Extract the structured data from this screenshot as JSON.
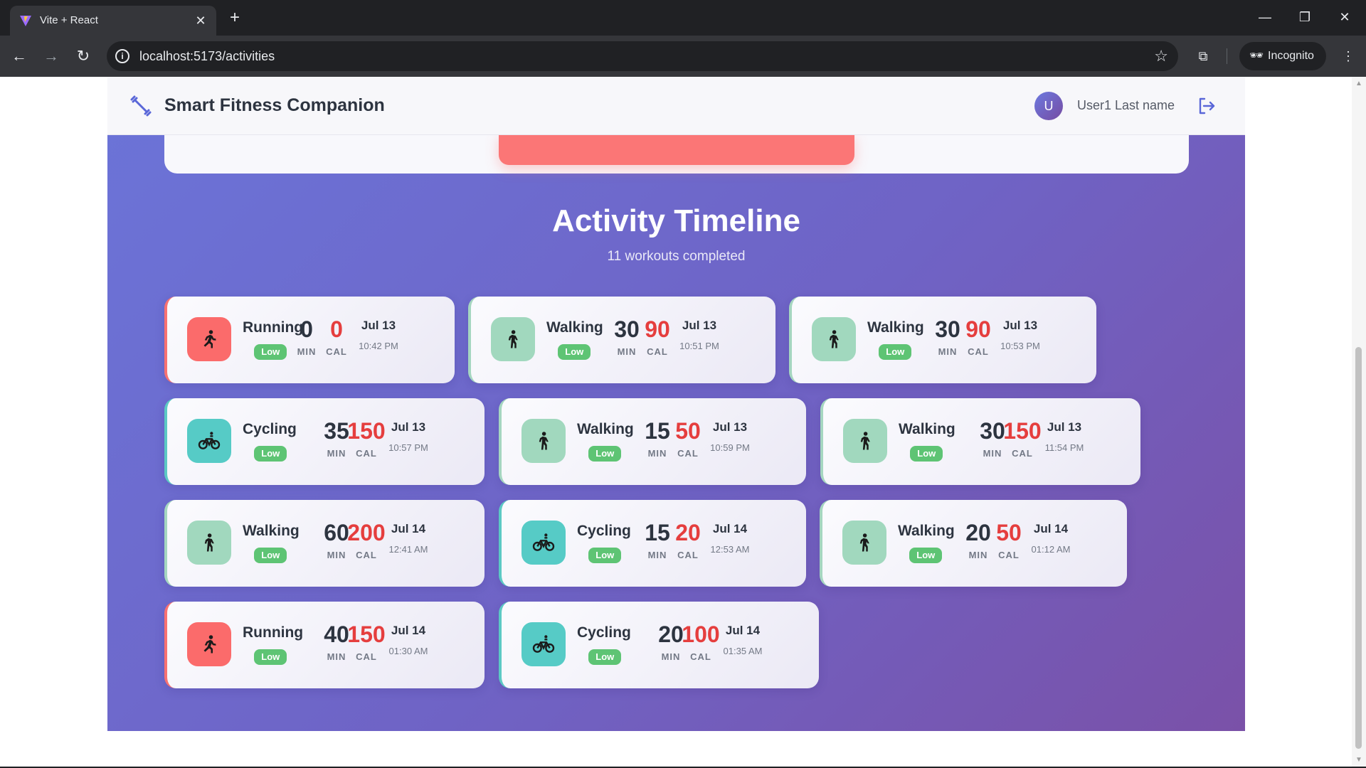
{
  "browser": {
    "tab_title": "Vite + React",
    "url": "localhost:5173/activities",
    "incognito_label": "Incognito"
  },
  "app": {
    "title": "Smart Fitness Companion",
    "user_initial": "U",
    "user_name": "User1 Last name"
  },
  "page": {
    "title": "Activity Timeline",
    "subtitle": "11 workouts completed"
  },
  "labels": {
    "min": "MIN",
    "cal": "CAL"
  },
  "colors": {
    "running": "#fb6b6b",
    "walking": "#a1d8be",
    "cycling": "#56cbc6",
    "badge": "#5ec474",
    "calories": "#e53e3e"
  },
  "activities": [
    {
      "type": "Running",
      "intensity": "Low",
      "minutes": "0",
      "calories": "0",
      "date": "Jul 13",
      "time": "10:42 PM"
    },
    {
      "type": "Walking",
      "intensity": "Low",
      "minutes": "30",
      "calories": "90",
      "date": "Jul 13",
      "time": "10:51 PM"
    },
    {
      "type": "Walking",
      "intensity": "Low",
      "minutes": "30",
      "calories": "90",
      "date": "Jul 13",
      "time": "10:53 PM"
    },
    {
      "type": "Cycling",
      "intensity": "Low",
      "minutes": "35",
      "calories": "150",
      "date": "Jul 13",
      "time": "10:57 PM"
    },
    {
      "type": "Walking",
      "intensity": "Low",
      "minutes": "15",
      "calories": "50",
      "date": "Jul 13",
      "time": "10:59 PM"
    },
    {
      "type": "Walking",
      "intensity": "Low",
      "minutes": "30",
      "calories": "150",
      "date": "Jul 13",
      "time": "11:54 PM"
    },
    {
      "type": "Walking",
      "intensity": "Low",
      "minutes": "60",
      "calories": "200",
      "date": "Jul 14",
      "time": "12:41 AM"
    },
    {
      "type": "Cycling",
      "intensity": "Low",
      "minutes": "15",
      "calories": "20",
      "date": "Jul 14",
      "time": "12:53 AM"
    },
    {
      "type": "Walking",
      "intensity": "Low",
      "minutes": "20",
      "calories": "50",
      "date": "Jul 14",
      "time": "01:12 AM"
    },
    {
      "type": "Running",
      "intensity": "Low",
      "minutes": "40",
      "calories": "150",
      "date": "Jul 14",
      "time": "01:30 AM"
    },
    {
      "type": "Cycling",
      "intensity": "Low",
      "minutes": "20",
      "calories": "100",
      "date": "Jul 14",
      "time": "01:35 AM"
    }
  ]
}
